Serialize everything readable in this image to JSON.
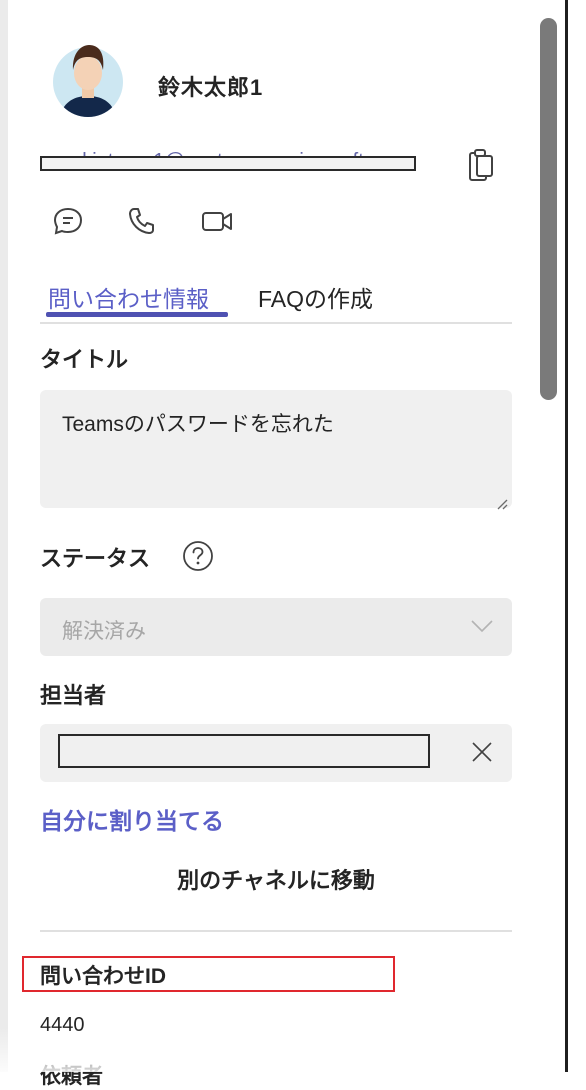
{
  "contact": {
    "name": "鈴木太郎1",
    "email": "suzuki_taro_1@contoso.onmicrosoft.com"
  },
  "actions": {
    "chat_icon": "chat-icon",
    "call_icon": "phone-icon",
    "video_icon": "video-icon",
    "copy_icon": "copy-icon"
  },
  "tabs": [
    {
      "label": "問い合わせ情報",
      "active": true
    },
    {
      "label": "FAQの作成",
      "active": false
    }
  ],
  "form": {
    "title_label": "タイトル",
    "title_value": "Teamsのパスワードを忘れた",
    "status_label": "ステータス",
    "status_value": "解決済み",
    "assignee_label": "担当者",
    "assign_me_link": "自分に割り当てる",
    "move_channel_button": "別のチャネルに移動"
  },
  "inquiry": {
    "id_label": "問い合わせID",
    "id_value": "4440",
    "next_label": "依頼者"
  },
  "colors": {
    "accent": "#5b5fc7",
    "highlight": "#e0282e"
  }
}
